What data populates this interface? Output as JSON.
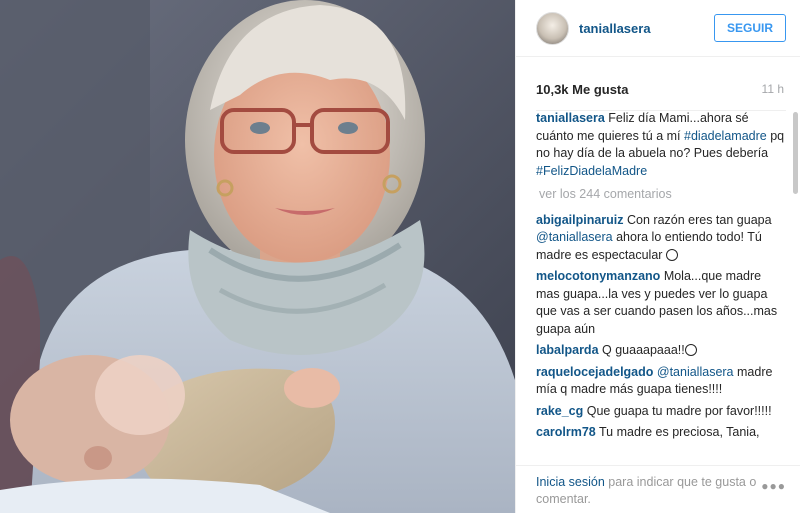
{
  "header": {
    "username": "taniallasera",
    "follow_label": "SEGUIR"
  },
  "stats": {
    "likes": "10,3k Me gusta",
    "time": "11 h"
  },
  "caption": {
    "author": "taniallasera",
    "text_1": "Feliz día Mami...ahora sé cuánto me quieres tú a mí",
    "tag_1": "#diadelamadre",
    "text_2": "pq no hay día de la abuela no? Pues debería",
    "tag_2": "#FelizDiadelaMadre"
  },
  "view_all": "ver los 244 comentarios",
  "comments": [
    {
      "author": "abigailpinaruiz",
      "text_before": "Con razón eres tan guapa",
      "mention": "@taniallasera",
      "text_after": "ahora lo entiendo todo! Tú madre es espectacular",
      "emoji": "smiling-face"
    },
    {
      "author": "melocotonymanzano",
      "text": "Mola...que madre mas guapa...la ves y puedes ver lo guapa que vas a ser cuando pasen los años...mas guapa aún"
    },
    {
      "author": "labalparda",
      "text": "Q guaaapaaa!!",
      "emoji": "heart-eyes-face"
    },
    {
      "author": "raquelocejadelgado",
      "mention": "@taniallasera",
      "text": "madre mía q madre más guapa tienes!!!!"
    },
    {
      "author": "rake_cg",
      "text": "Que guapa tu madre por favor!!!!!"
    },
    {
      "author": "carolrm78",
      "text": "Tu madre es preciosa, Tania,"
    }
  ],
  "footer": {
    "login_link": "Inicia sesión",
    "text": "para indicar que te gusta o comentar.",
    "more_icon": "more-options-icon"
  }
}
